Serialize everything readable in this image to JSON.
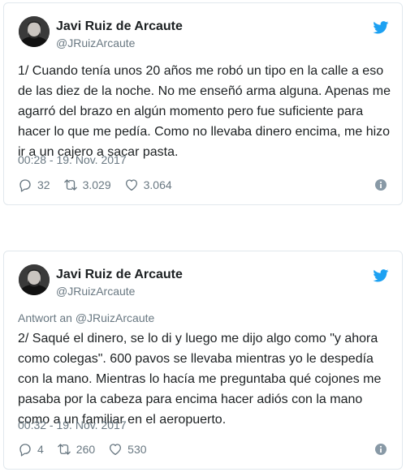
{
  "tweets": [
    {
      "author": {
        "name": "Javi Ruiz de Arcaute",
        "handle": "@JRuizArcaute"
      },
      "reply_to": null,
      "text": "1/ Cuando tenía unos 20 años me robó un tipo en la calle a eso de las diez de la noche. No me enseñó arma alguna. Apenas me agarró del brazo en algún momento pero fue suficiente para hacer lo que me pedía. Como no llevaba dinero encima, me hizo ir a un cajero a sacar pasta.",
      "timestamp": "00:28 - 19. Nov. 2017",
      "stats": {
        "replies": "32",
        "retweets": "3.029",
        "likes": "3.064"
      }
    },
    {
      "author": {
        "name": "Javi Ruiz de Arcaute",
        "handle": "@JRuizArcaute"
      },
      "reply_to": {
        "prefix": "Antwort an",
        "handle": "@JRuizArcaute"
      },
      "text": "2/ Saqué el dinero, se lo di y luego me dijo algo como \"y ahora como colegas\". 600 pavos se llevaba mientras yo le despedía con la mano. Mientras lo hacía me preguntaba qué cojones me pasaba por la cabeza para encima hacer adiós con la mano como a un familiar en el aeropuerto.",
      "timestamp": "00:32 - 19. Nov. 2017",
      "stats": {
        "replies": "4",
        "retweets": "260",
        "likes": "530"
      }
    }
  ],
  "icons": {
    "brand": "twitter-bird-icon",
    "reply": "reply-icon",
    "retweet": "retweet-icon",
    "like": "heart-icon",
    "info": "info-icon"
  },
  "colors": {
    "brand_blue": "#1da1f2",
    "text": "#1c2022",
    "muted": "#697882",
    "border": "#e1e8ed"
  }
}
